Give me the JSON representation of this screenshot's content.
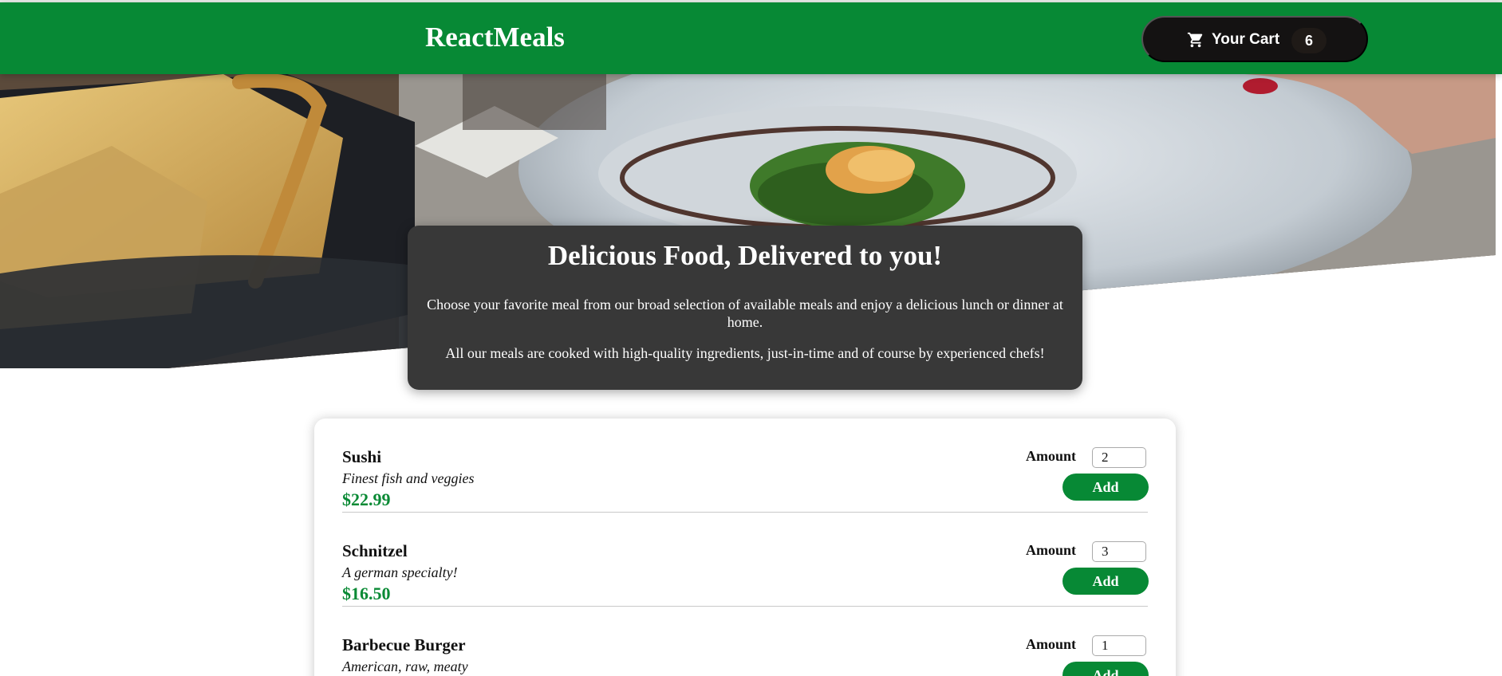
{
  "header": {
    "brand": "ReactMeals",
    "cart_label": "Your Cart",
    "cart_count": "6",
    "icon": "cart-icon"
  },
  "summary": {
    "title": "Delicious Food, Delivered to you!",
    "paragraph1": "Choose your favorite meal from our broad selection of available meals and enjoy a delicious lunch or dinner at home.",
    "paragraph2": "All our meals are cooked with high-quality ingredients, just-in-time and of course by experienced chefs!"
  },
  "meals": [
    {
      "name": "Sushi",
      "description": "Finest fish and veggies",
      "price": "$22.99",
      "amount_label": "Amount",
      "amount": "2",
      "add_label": "Add"
    },
    {
      "name": "Schnitzel",
      "description": "A german specialty!",
      "price": "$16.50",
      "amount_label": "Amount",
      "amount": "3",
      "add_label": "Add"
    },
    {
      "name": "Barbecue Burger",
      "description": "American, raw, meaty",
      "price": "",
      "amount_label": "Amount",
      "amount": "1",
      "add_label": "Add"
    }
  ],
  "colors": {
    "brand_green": "#078935",
    "price_green": "#0a8a35",
    "cart_bg": "#141212",
    "summary_bg": "#383838"
  }
}
